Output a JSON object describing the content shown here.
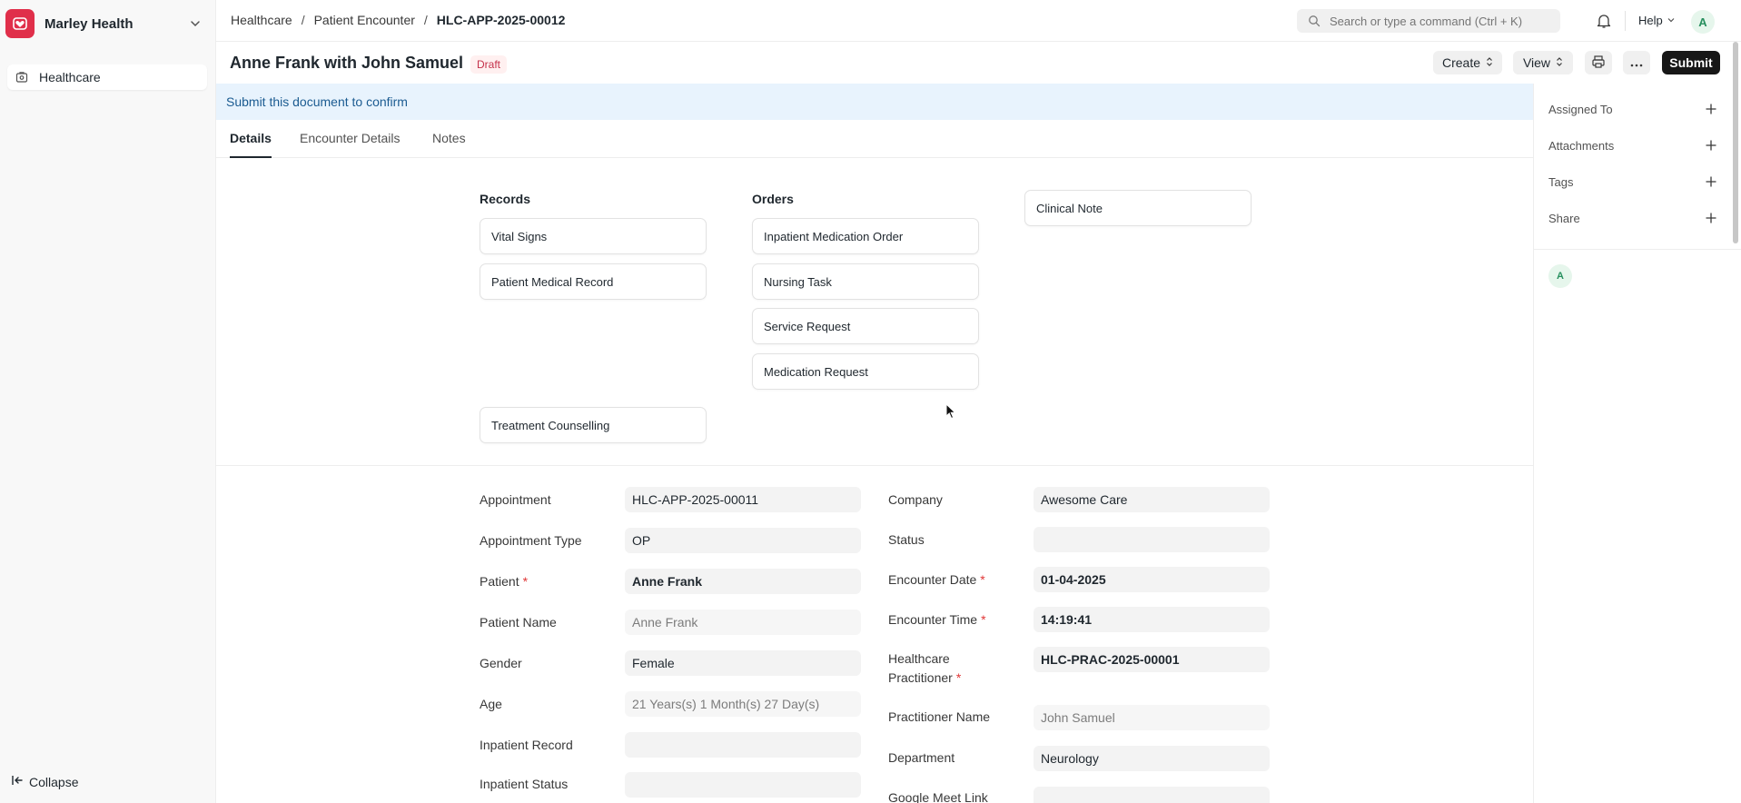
{
  "sidebar": {
    "brand": "Marley Health",
    "items": [
      {
        "label": "Healthcare",
        "icon": "healthcare-icon"
      }
    ],
    "collapse_label": "Collapse"
  },
  "topbar": {
    "breadcrumbs": [
      "Healthcare",
      "Patient Encounter",
      "HLC-APP-2025-00012"
    ],
    "search_placeholder": "Search or type a command (Ctrl + K)",
    "help_label": "Help",
    "avatar_initial": "A"
  },
  "page": {
    "title": "Anne Frank with John Samuel",
    "status_badge": "Draft",
    "buttons": {
      "create": "Create",
      "view": "View",
      "submit": "Submit"
    },
    "banner": "Submit this document to confirm"
  },
  "tabs": [
    "Details",
    "Encounter Details",
    "Notes"
  ],
  "right_sidebar": {
    "items": [
      "Assigned To",
      "Attachments",
      "Tags",
      "Share"
    ],
    "avatar_initial": "A"
  },
  "dashboard": {
    "records_heading": "Records",
    "records": [
      "Vital Signs",
      "Patient Medical Record"
    ],
    "orders_heading": "Orders",
    "orders": [
      "Inpatient Medication Order",
      "Nursing Task",
      "Service Request",
      "Medication Request"
    ],
    "clinical_note": "Clinical Note",
    "treatment_counselling": "Treatment Counselling"
  },
  "form": {
    "left": [
      {
        "label": "Appointment",
        "value": "HLC-APP-2025-00011",
        "required": false
      },
      {
        "label": "Appointment Type",
        "value": "OP",
        "required": false
      },
      {
        "label": "Patient",
        "value": "Anne Frank",
        "required": true
      },
      {
        "label": "Patient Name",
        "value": "Anne Frank",
        "required": false
      },
      {
        "label": "Gender",
        "value": "Female",
        "required": false
      },
      {
        "label": "Age",
        "value": "21 Years(s) 1 Month(s) 27 Day(s)",
        "required": false
      },
      {
        "label": "Inpatient Record",
        "value": "",
        "required": false
      },
      {
        "label": "Inpatient Status",
        "value": "",
        "required": false
      }
    ],
    "right": [
      {
        "label": "Company",
        "value": "Awesome Care",
        "required": false
      },
      {
        "label": "Status",
        "value": "",
        "required": false
      },
      {
        "label": "Encounter Date",
        "value": "01-04-2025",
        "required": true
      },
      {
        "label": "Encounter Time",
        "value": "14:19:41",
        "required": true
      },
      {
        "label_line1": "Healthcare",
        "label_line2": "Practitioner",
        "value": "HLC-PRAC-2025-00001",
        "required": true
      },
      {
        "label": "Practitioner Name",
        "value": "John Samuel",
        "required": false
      },
      {
        "label": "Department",
        "value": "Neurology",
        "required": false
      },
      {
        "label": "Google Meet Link",
        "value": "",
        "required": false
      }
    ],
    "required_mark": "*"
  },
  "colors": {
    "brand": "#e02f4a",
    "banner_bg": "#e8f3fd",
    "draft_text": "#c4314b",
    "submit_bg": "#171717"
  }
}
